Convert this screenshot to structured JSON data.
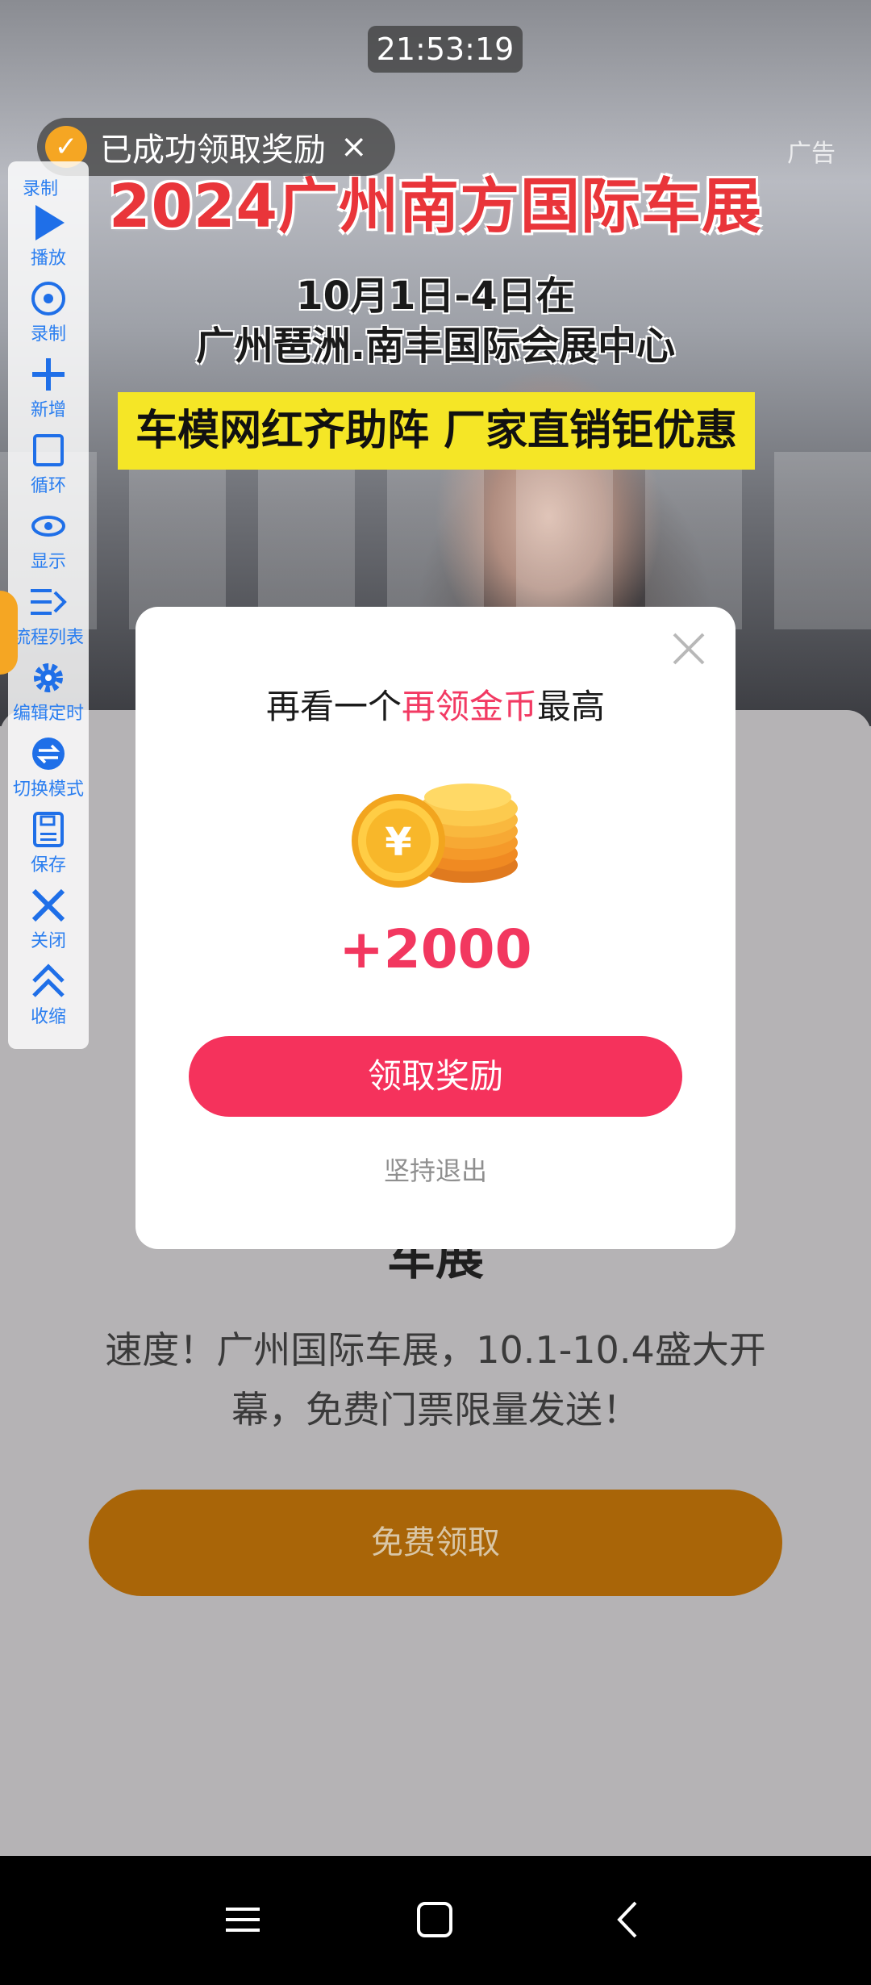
{
  "status": {
    "time": "21:53:19"
  },
  "toast": {
    "text": "已成功领取奖励",
    "close_label": "×",
    "check_icon": "check-circle-icon"
  },
  "video": {
    "ad_label": "广告",
    "title": "2024广州南方国际车展",
    "date_line1": "10月1日-4日在",
    "date_line2": "广州琶洲.南丰国际会展中心",
    "banner": "车模网红齐助阵 厂家直销钜优惠"
  },
  "toolbar": {
    "header": "录制",
    "items": [
      {
        "label": "播放",
        "icon": "play-icon"
      },
      {
        "label": "录制",
        "icon": "record-icon"
      },
      {
        "label": "新增",
        "icon": "plus-icon"
      },
      {
        "label": "循环",
        "icon": "loop-icon"
      },
      {
        "label": "显示",
        "icon": "eye-icon"
      },
      {
        "label": "流程列表",
        "icon": "list-icon"
      },
      {
        "label": "编辑定时",
        "icon": "gear-icon"
      },
      {
        "label": "切换模式",
        "icon": "switch-icon"
      },
      {
        "label": "保存",
        "icon": "save-icon"
      },
      {
        "label": "关闭",
        "icon": "close-icon"
      },
      {
        "label": "收缩",
        "icon": "collapse-icon"
      }
    ]
  },
  "dialog": {
    "headline_prefix": "再看一个",
    "headline_highlight": "再领金币",
    "headline_suffix": "最高",
    "amount": "+2000",
    "primary_button": "领取奖励",
    "secondary_link": "坚持退出",
    "accent_color": "#f5325c"
  },
  "landing": {
    "title_partial": "车展",
    "description": "速度！广州国际车展，10.1-10.4盛大开幕，免费门票限量发送！",
    "cta": "免费领取",
    "cta_color": "#a96508"
  },
  "navbar": {
    "menu_icon": "menu-icon",
    "home_icon": "home-square-icon",
    "back_icon": "back-chevron-icon"
  }
}
